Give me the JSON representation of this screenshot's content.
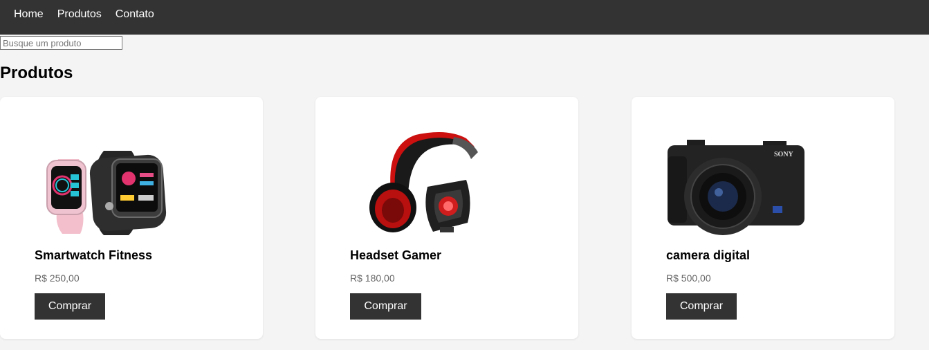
{
  "nav": {
    "items": [
      {
        "label": "Home"
      },
      {
        "label": "Produtos"
      },
      {
        "label": "Contato"
      }
    ]
  },
  "search": {
    "placeholder": "Busque um produto",
    "value": ""
  },
  "page_title": "Produtos",
  "products": [
    {
      "name": "Smartwatch Fitness",
      "price": "R$ 250,00",
      "button_label": "Comprar",
      "image": "smartwatch-image"
    },
    {
      "name": "Headset Gamer",
      "price": "R$ 180,00",
      "button_label": "Comprar",
      "image": "headset-image"
    },
    {
      "name": "camera digital",
      "price": "R$ 500,00",
      "button_label": "Comprar",
      "image": "camera-image",
      "image_brand_text": "SONY"
    }
  ],
  "colors": {
    "navbar_bg": "#333333",
    "page_bg": "#f4f4f4",
    "card_bg": "#ffffff",
    "button_bg": "#333333",
    "price_text": "#666666"
  }
}
